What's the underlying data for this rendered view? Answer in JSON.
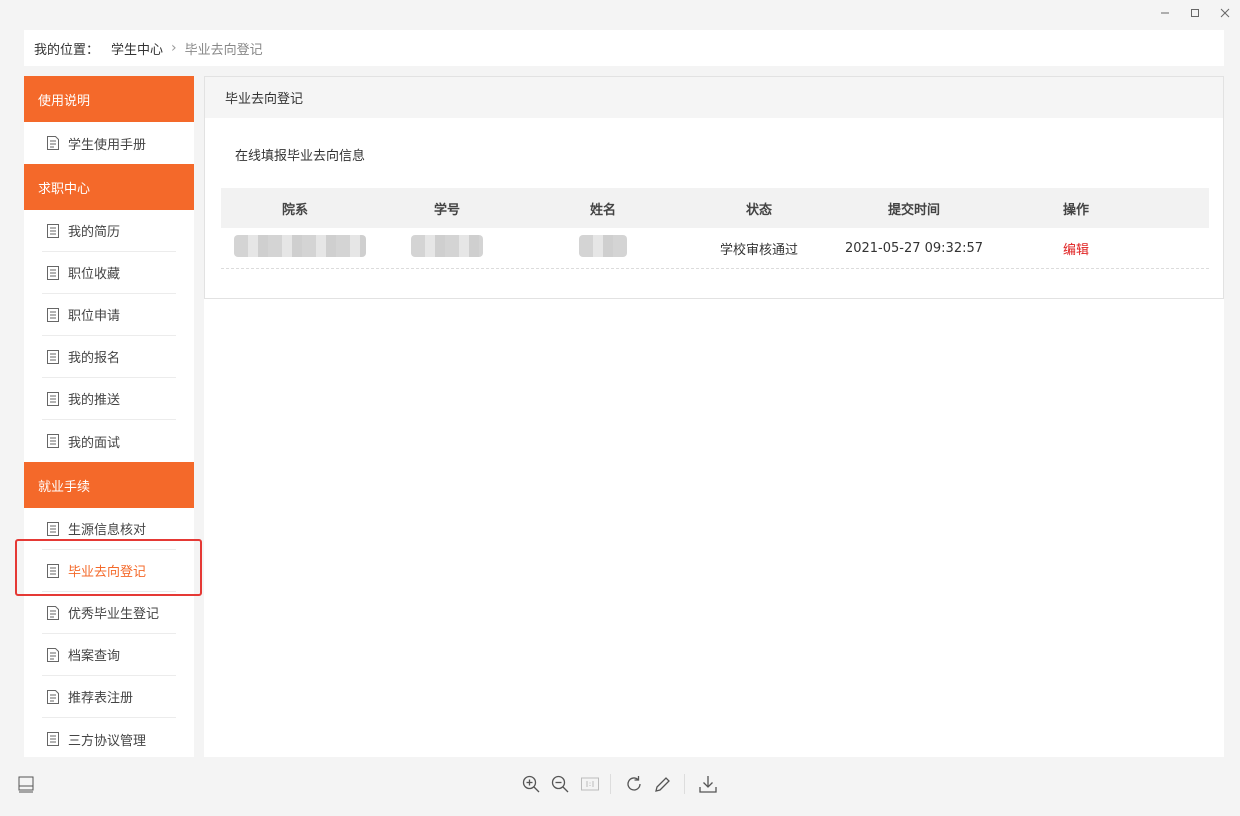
{
  "breadcrumb": {
    "label": "我的位置：",
    "parent": "学生中心",
    "current": "毕业去向登记"
  },
  "sidebar": {
    "groups": [
      {
        "title": "使用说明",
        "items": [
          "学生使用手册"
        ]
      },
      {
        "title": "求职中心",
        "items": [
          "我的简历",
          "职位收藏",
          "职位申请",
          "我的报名",
          "我的推送",
          "我的面试"
        ]
      },
      {
        "title": "就业手续",
        "items": [
          "生源信息核对",
          "毕业去向登记",
          "优秀毕业生登记",
          "档案查询",
          "推荐表注册",
          "三方协议管理"
        ]
      }
    ],
    "active_item": "毕业去向登记"
  },
  "panel": {
    "title": "毕业去向登记",
    "description": "在线填报毕业去向信息"
  },
  "table": {
    "columns": [
      "院系",
      "学号",
      "姓名",
      "状态",
      "提交时间",
      "操作"
    ],
    "rows": [
      {
        "status": "学校审核通过",
        "submit_time": "2021-05-27 09:32:57",
        "action": "编辑"
      }
    ]
  },
  "colors": {
    "accent": "#f4692a",
    "highlight": "#e53935",
    "edit": "#e02020"
  }
}
